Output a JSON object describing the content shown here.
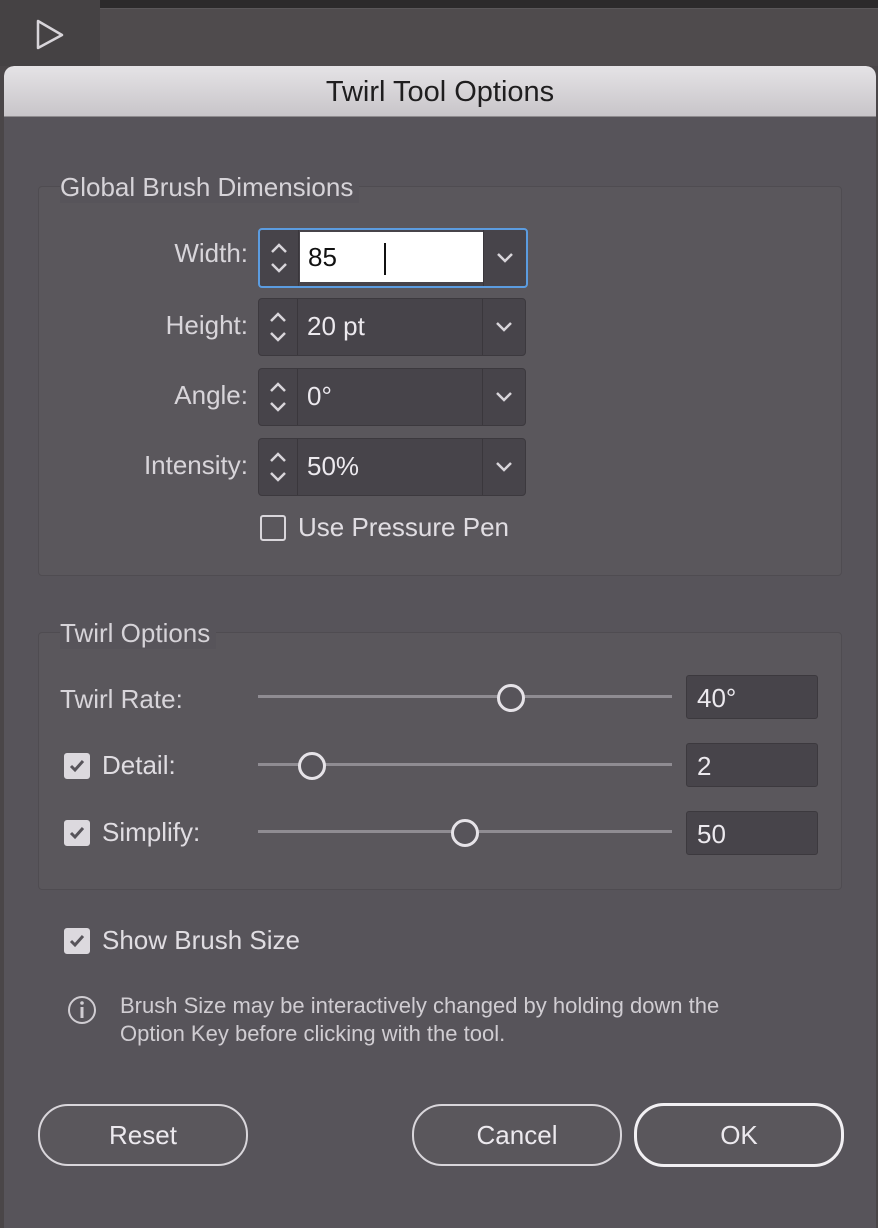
{
  "dialog": {
    "title": "Twirl Tool Options"
  },
  "global_brush": {
    "title": "Global Brush Dimensions",
    "width": {
      "label": "Width:",
      "value": "85"
    },
    "height": {
      "label": "Height:",
      "value": "20 pt"
    },
    "angle": {
      "label": "Angle:",
      "value": "0°"
    },
    "intensity": {
      "label": "Intensity:",
      "value": "50%"
    },
    "use_pressure_pen": {
      "label": "Use Pressure Pen",
      "checked": false
    }
  },
  "twirl_options": {
    "title": "Twirl Options",
    "twirl_rate": {
      "label": "Twirl Rate:",
      "value": "40°",
      "slider_fraction": 0.61
    },
    "detail": {
      "label": "Detail:",
      "value": "2",
      "checked": true,
      "slider_fraction": 0.13
    },
    "simplify": {
      "label": "Simplify:",
      "value": "50",
      "checked": true,
      "slider_fraction": 0.5
    }
  },
  "show_brush_size": {
    "label": "Show Brush Size",
    "checked": true
  },
  "info": {
    "line1": "Brush Size may be interactively changed by holding down the",
    "line2": "Option Key before clicking with the tool."
  },
  "buttons": {
    "reset": "Reset",
    "cancel": "Cancel",
    "ok": "OK"
  },
  "icons": {
    "selection": "selection-arrow-icon",
    "spin": "stepper-icon",
    "dropdown": "chevron-down-icon",
    "check": "checkmark-icon",
    "info": "info-icon"
  },
  "colors": {
    "dialog_bg": "#57545a",
    "focus_ring": "#5b9ce0"
  }
}
